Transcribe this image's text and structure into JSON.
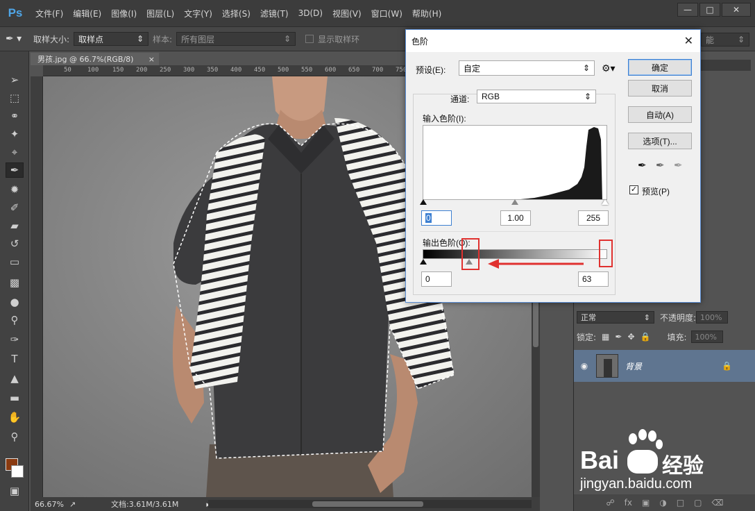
{
  "app": {
    "logo": "Ps",
    "menus": [
      "文件(F)",
      "编辑(E)",
      "图像(I)",
      "图层(L)",
      "文字(Y)",
      "选择(S)",
      "滤镜(T)",
      "3D(D)",
      "视图(V)",
      "窗口(W)",
      "帮助(H)"
    ],
    "window_controls": [
      "—",
      "□",
      "✕"
    ]
  },
  "options": {
    "sample_size_label": "取样大小:",
    "sample_size_value": "取样点",
    "sample_label": "样本:",
    "sample_value": "所有图层",
    "show_ring_label": "显示取样环",
    "right_partial": "能"
  },
  "document": {
    "tab_title": "男孩.jpg @ 66.7%(RGB/8)",
    "tab_close": "×",
    "ruler_ticks": [
      "50",
      "100",
      "150",
      "200",
      "250",
      "300",
      "350",
      "400",
      "450",
      "500",
      "550",
      "600",
      "650",
      "700",
      "750"
    ],
    "zoom": "66.67%",
    "doc_size": "文档:3.61M/3.61M"
  },
  "dialog": {
    "title": "色阶",
    "preset_label": "预设(E):",
    "preset_value": "自定",
    "channel_label": "通道:",
    "channel_value": "RGB",
    "input_levels_label": "输入色阶(I):",
    "input_black": "0",
    "input_mid": "1.00",
    "input_white": "255",
    "output_levels_label": "输出色阶(O):",
    "output_black": "0",
    "output_white": "63",
    "buttons": {
      "ok": "确定",
      "cancel": "取消",
      "auto": "自动(A)",
      "options": "选项(T)..."
    },
    "preview_label": "预览(P)",
    "preview_checked": true
  },
  "layers": {
    "blend_mode": "正常",
    "opacity_label": "不透明度:",
    "opacity_value": "100%",
    "lock_label": "锁定:",
    "fill_label": "填充:",
    "fill_value": "100%",
    "layer_name": "背景"
  },
  "watermark": {
    "brand": "Bai",
    "brand_cn": "经验",
    "url": "jingyan.baidu.com"
  },
  "colors": {
    "accent": "#4fa6e8",
    "highlight": "#e0312f",
    "layer_selected": "#5f7590",
    "foreground_swatch": "#8a3a10"
  }
}
